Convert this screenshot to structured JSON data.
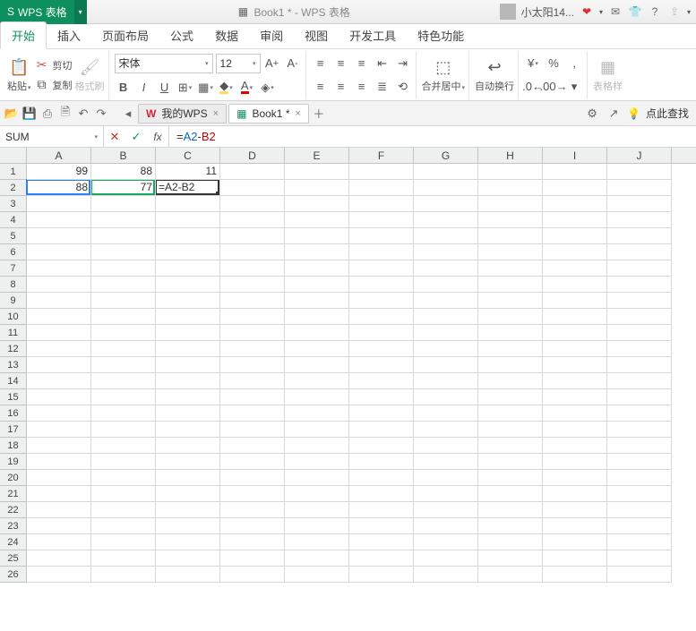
{
  "app": {
    "name": "WPS 表格",
    "doc_title": "Book1 * - WPS 表格"
  },
  "user": {
    "name": "小太阳14..."
  },
  "menus": [
    "开始",
    "插入",
    "页面布局",
    "公式",
    "数据",
    "审阅",
    "视图",
    "开发工具",
    "特色功能"
  ],
  "ribbon": {
    "paste": "粘贴",
    "cut": "剪切",
    "copy": "复制",
    "fmtpaint": "格式刷",
    "font": "宋体",
    "size": "12",
    "merge": "合并居中",
    "wrap": "自动换行",
    "cellfmt": "表格样"
  },
  "qat": {
    "my_wps": "我的WPS",
    "doc": "Book1 *",
    "hint": "点此查找"
  },
  "namebox": "SUM",
  "formula": {
    "prefix": "=",
    "a": "A2",
    "dash": "-",
    "b": "B2"
  },
  "cols": [
    "A",
    "B",
    "C",
    "D",
    "E",
    "F",
    "G",
    "H",
    "I",
    "J"
  ],
  "rows": [
    "1",
    "2",
    "3",
    "4",
    "5",
    "6",
    "7",
    "8",
    "9",
    "10",
    "11",
    "12",
    "13",
    "14",
    "15",
    "16",
    "17",
    "18",
    "19",
    "20",
    "21",
    "22",
    "23",
    "24",
    "25",
    "26"
  ],
  "cells": {
    "A1": "99",
    "B1": "88",
    "C1": "11",
    "A2": "88",
    "B2": "77",
    "C2": "=A2-B2"
  },
  "chart_data": {
    "type": "table",
    "columns": [
      "A",
      "B",
      "C"
    ],
    "rows": [
      {
        "A": 99,
        "B": 88,
        "C": 11
      },
      {
        "A": 88,
        "B": 77,
        "C": "=A2-B2"
      }
    ]
  }
}
